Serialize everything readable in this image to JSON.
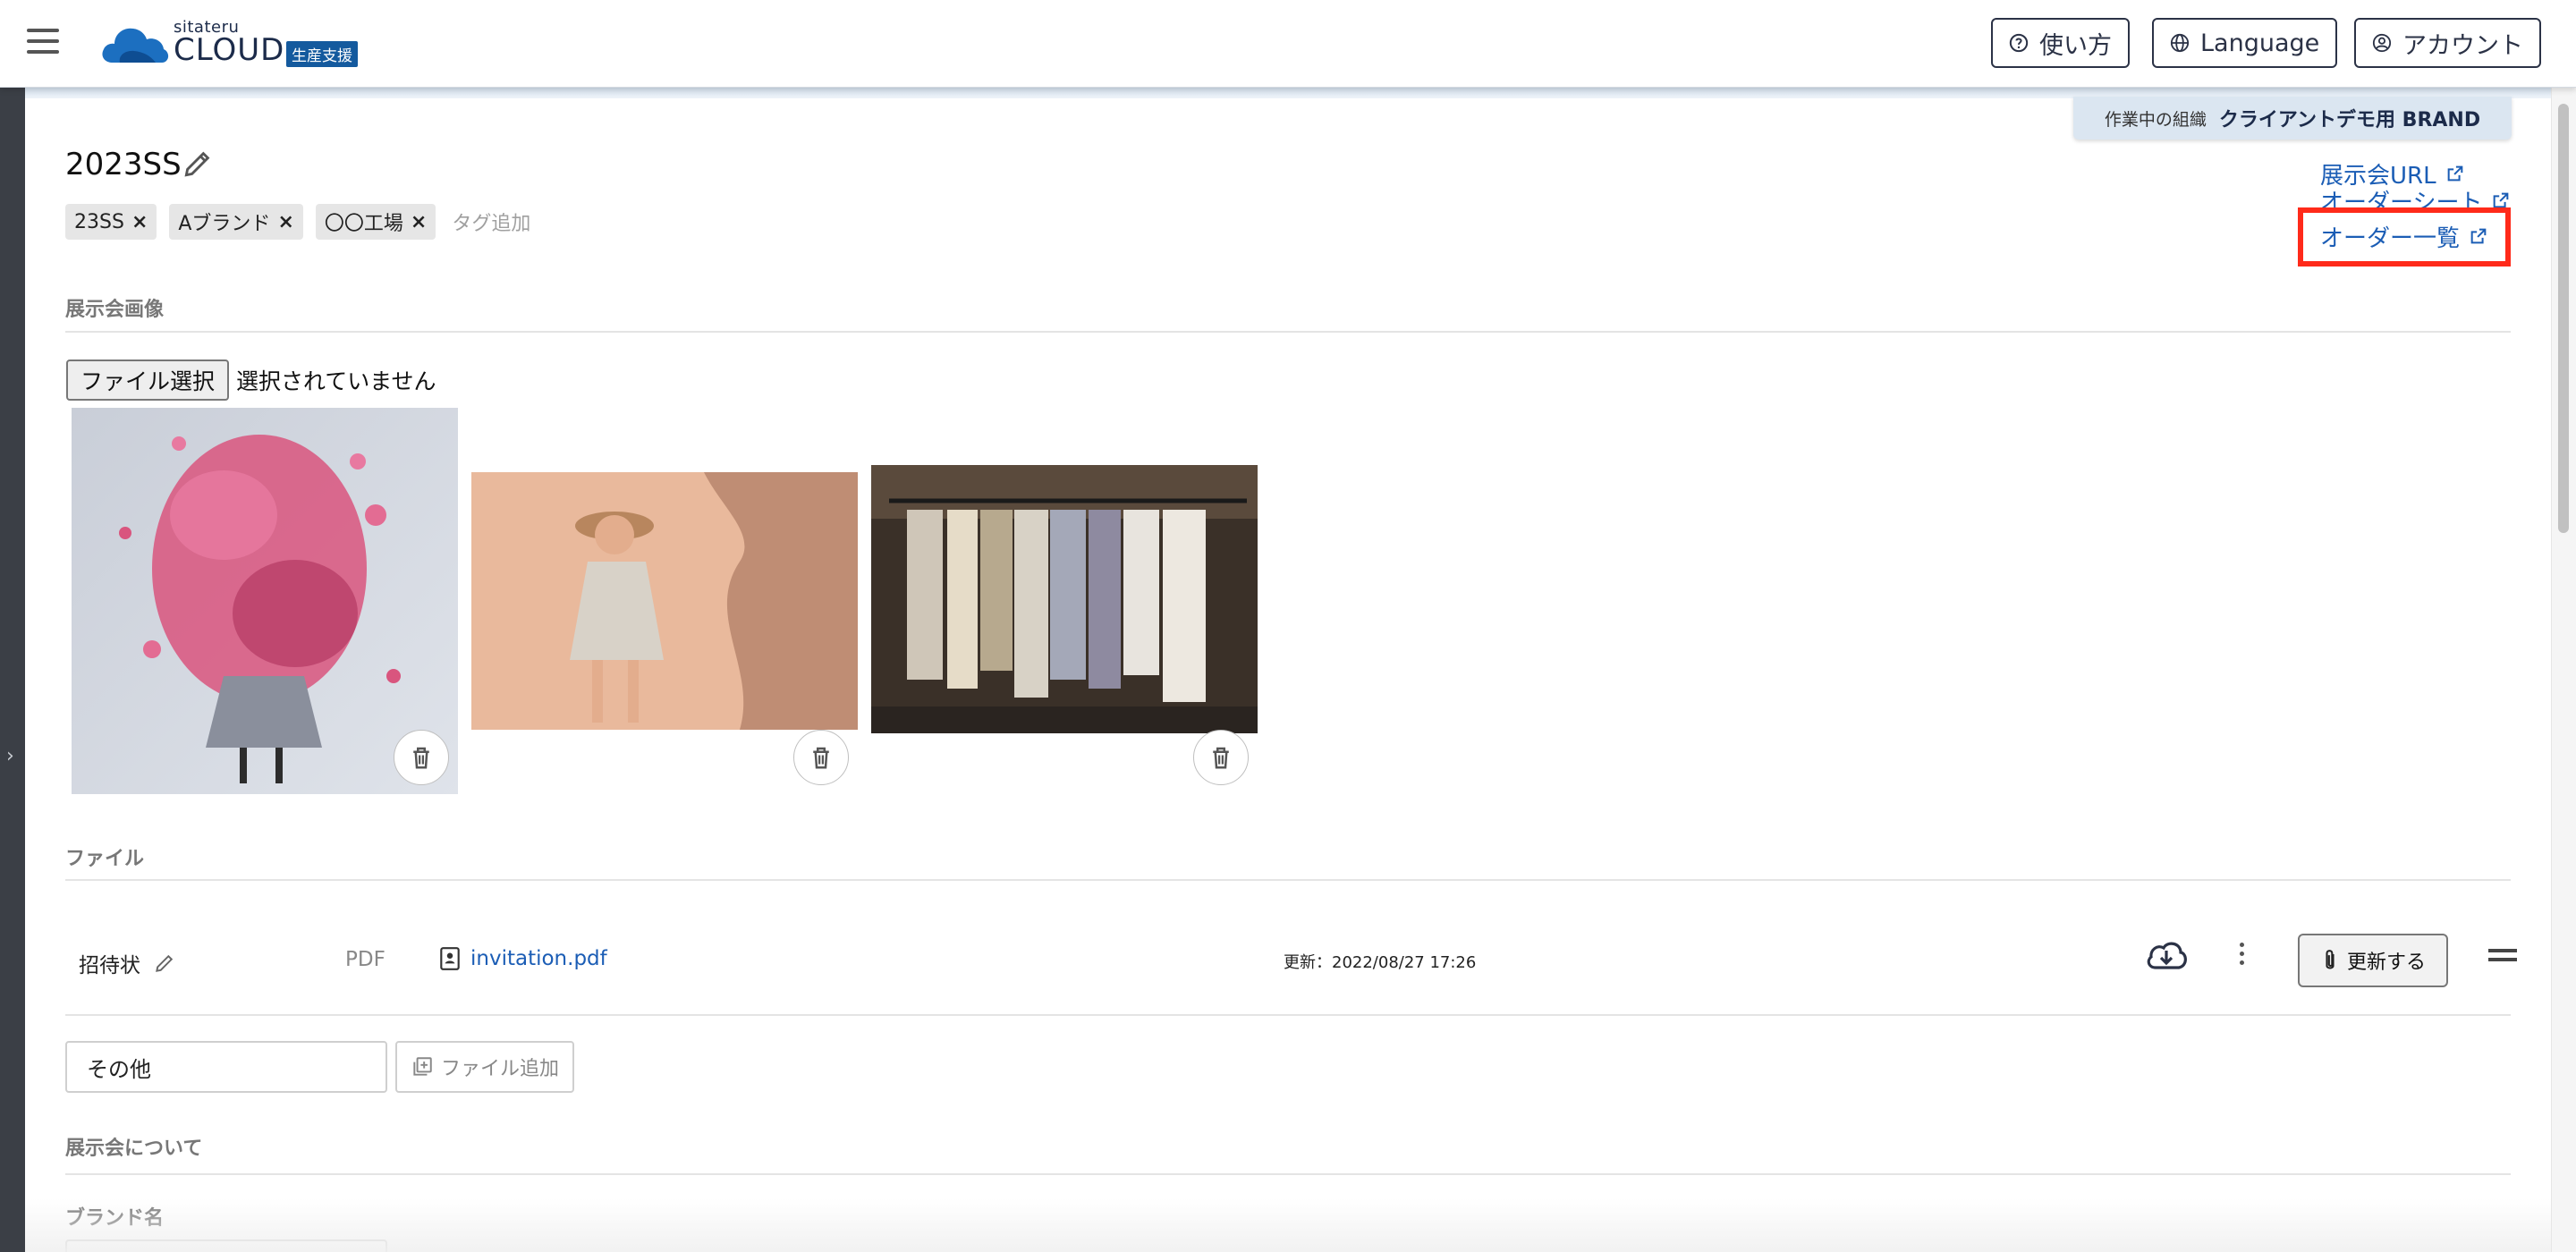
{
  "header": {
    "logo_small": "sitateru",
    "logo_main": "CLOUD",
    "logo_badge": "生産支援",
    "help_label": "使い方",
    "language_label": "Language",
    "account_label": "アカウント"
  },
  "org": {
    "label": "作業中の組織",
    "name": "クライアントデモ用 BRAND"
  },
  "exhibition": {
    "title": "2023SS",
    "tags": [
      "23SS",
      "Aブランド",
      "〇〇工場"
    ],
    "tag_add_placeholder": "タグ追加"
  },
  "links": {
    "exhibition_url": "展示会URL",
    "order_sheet": "オーダーシート",
    "order_list": "オーダー一覧"
  },
  "images_section": {
    "label": "展示会画像",
    "file_button": "ファイル選択",
    "file_status": "選択されていません"
  },
  "files_section": {
    "label": "ファイル",
    "rows": [
      {
        "name": "招待状",
        "type": "PDF",
        "filename": "invitation.pdf",
        "updated": "更新：2022/08/27 17:26",
        "update_button": "更新する"
      }
    ],
    "other_input_value": "その他",
    "add_file_button": "ファイル追加"
  },
  "about_section": {
    "label": "展示会について",
    "brand_label": "ブランド名"
  },
  "colors": {
    "link": "#1b5db5",
    "highlight": "#ff2a1a",
    "brand_badge": "#145a9e",
    "org_tab": "#dbe6f1"
  },
  "icons": [
    "menu-icon",
    "cloud-logo-icon",
    "help-circle-icon",
    "globe-icon",
    "user-circle-icon",
    "pencil-icon",
    "close-icon",
    "external-link-icon",
    "trash-icon",
    "document-person-icon",
    "cloud-download-icon",
    "more-vertical-icon",
    "paperclip-icon",
    "drag-handle-icon",
    "add-file-icon",
    "chevron-right-icon"
  ]
}
